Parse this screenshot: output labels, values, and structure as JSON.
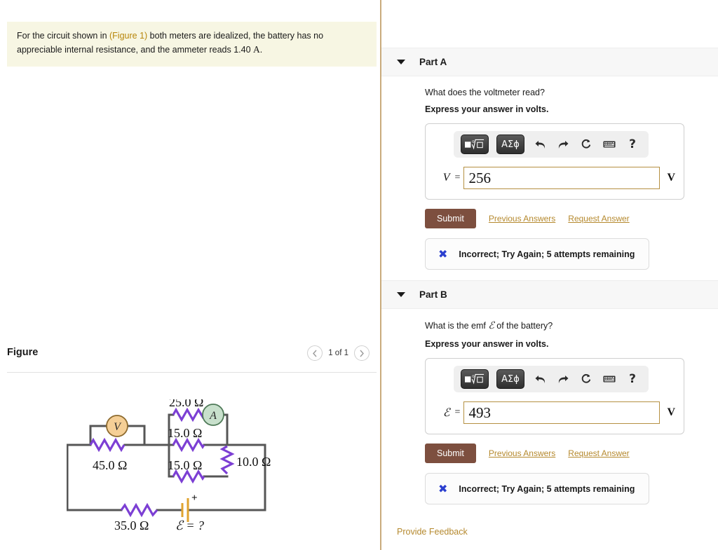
{
  "problem": {
    "text_before_link": "For the circuit shown in ",
    "figure_link": "(Figure 1)",
    "text_after_link": " both meters are idealized, the battery has no appreciable internal resistance, and the ammeter reads 1.40 ",
    "ammeter_unit": "A",
    "text_end": "."
  },
  "figure": {
    "title": "Figure",
    "counter": "1 of 1",
    "prev_icon": "chevron-left-icon",
    "next_icon": "chevron-right-icon",
    "circuit": {
      "voltmeter_label": "V",
      "ammeter_label": "A",
      "resistors": [
        {
          "name": "r45",
          "label": "45.0 Ω"
        },
        {
          "name": "r25",
          "label": "25.0 Ω"
        },
        {
          "name": "r15a",
          "label": "15.0 Ω"
        },
        {
          "name": "r15b",
          "label": "15.0 Ω"
        },
        {
          "name": "r10",
          "label": "10.0 Ω"
        },
        {
          "name": "r35",
          "label": "35.0 Ω"
        }
      ],
      "battery_plus": "+",
      "emf_label": "ℰ = ?"
    }
  },
  "toolbar": {
    "sqrt_button": "math-template-button",
    "greek_button": "ΑΣϕ",
    "undo_icon": "undo-icon",
    "redo_icon": "redo-icon",
    "reset_icon": "reset-icon",
    "keyboard_icon": "keyboard-icon",
    "help_icon": "?"
  },
  "parts": [
    {
      "id": "part-a",
      "header": "Part A",
      "question": "What does the voltmeter read?",
      "express": "Express your answer in volts.",
      "symbol": "V",
      "equals": "=",
      "value": "256",
      "placeholder": "",
      "unit": "V",
      "submit_label": "Submit",
      "previous_answers_label": "Previous Answers",
      "request_answer_label": "Request Answer",
      "feedback": "Incorrect; Try Again; 5 attempts remaining"
    },
    {
      "id": "part-b",
      "header": "Part B",
      "question_pre": "What is the emf ",
      "question_sym": "ℰ",
      "question_post": " of the battery?",
      "question": "What is the emf ℰ of the battery?",
      "express": "Express your answer in volts.",
      "symbol": "ℰ",
      "equals": "=",
      "value": "493",
      "placeholder": "",
      "unit": "V",
      "submit_label": "Submit",
      "previous_answers_label": "Previous Answers",
      "request_answer_label": "Request Answer",
      "feedback": "Incorrect; Try Again; 5 attempts remaining"
    }
  ],
  "provide_feedback": "Provide Feedback",
  "colors": {
    "statement_bg": "#f7f6e3",
    "link_gold": "#b5892e",
    "submit_brown": "#7d4f3f",
    "input_border": "#b59042",
    "divider": "#c9ab7c",
    "voltmeter_fill": "#f5cf96",
    "ammeter_fill": "#c8e0cc",
    "resistor_purple": "#7c3fd4",
    "wire_gray": "#565656",
    "battery_gold": "#e0a32e",
    "x_blue": "#2b3fcf"
  }
}
